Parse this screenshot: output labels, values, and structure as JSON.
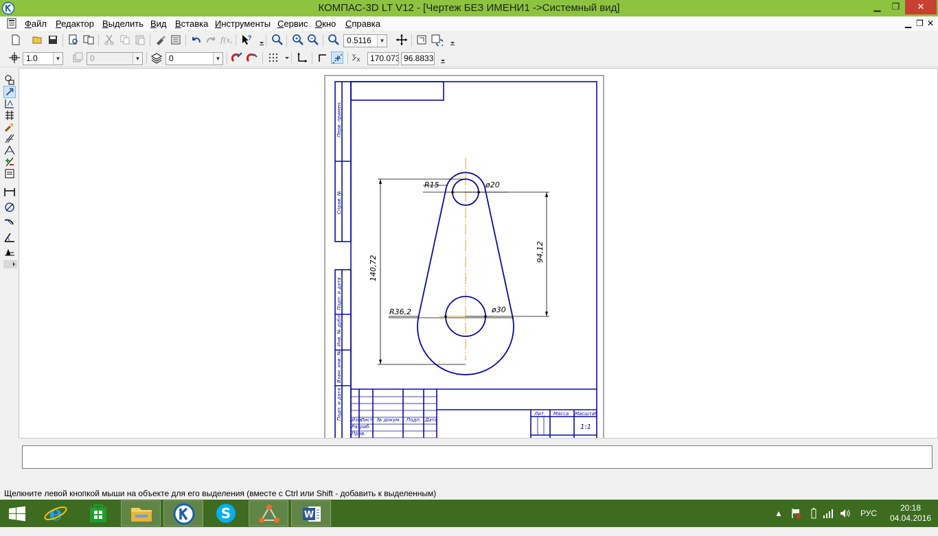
{
  "window": {
    "title": "КОМПАС-3D LT V12 - [Чертеж БЕЗ ИМЕНИ1 ->Системный вид]"
  },
  "menu": [
    {
      "label": "Файл",
      "u": "Ф",
      "rest": "айл"
    },
    {
      "label": "Редактор",
      "u": "Р",
      "rest": "едактор"
    },
    {
      "label": "Выделить",
      "u": "В",
      "rest": "ыделить"
    },
    {
      "label": "Вид",
      "u": "В",
      "rest": "ид"
    },
    {
      "label": "Вставка",
      "u": "В",
      "rest": "ставка"
    },
    {
      "label": "Инструменты",
      "u": "И",
      "rest": "нструменты"
    },
    {
      "label": "Сервис",
      "u": "С",
      "rest": "ервис"
    },
    {
      "label": "Окно",
      "u": "О",
      "rest": "кно"
    },
    {
      "label": "Справка",
      "u": "С",
      "rest": "правка"
    }
  ],
  "toolbar": {
    "zoom_value": "0.5116",
    "step_value": "1.0",
    "style_value": "0",
    "layer_value": "0",
    "coord_x": "170.073",
    "coord_y": "96.8833"
  },
  "drawing": {
    "dim_r15": "R15",
    "dim_d20": "ø20",
    "dim_r362": "R36,2",
    "dim_d30": "ø30",
    "dim_14072": "140,72",
    "dim_9412": "94,12",
    "stamp_lit": "Лит.",
    "stamp_massa": "Масса",
    "stamp_masshtab": "Масштаб",
    "stamp_scale": "1:1",
    "stamp_izm": "Изм.",
    "stamp_list": "Лист",
    "stamp_ndokum": "№ докум.",
    "stamp_podp": "Подп.",
    "stamp_data": "Дата",
    "stamp_razrab": "Разраб.",
    "stamp_prov": "Пров.",
    "side_perv": "Перв. примен.",
    "side_sprav": "Справ. №",
    "side_podp1": "Подп. и дата",
    "side_inv_dubl": "Инв. № дубл.",
    "side_vzam": "Взам. инв. №",
    "side_podp2": "Подп. и дата"
  },
  "status": {
    "message": "Щелкните левой кнопкой мыши на объекте для его выделения (вместе с Ctrl или Shift - добавить к выделенным)"
  },
  "tray": {
    "lang": "РУС",
    "time": "20:18",
    "date": "04.04.2016"
  },
  "colors": {
    "titlebar": "#8cc43f",
    "taskbar": "#3d6b1f",
    "drawing_line": "#0a0aa0",
    "axis_line": "#d9a030"
  }
}
